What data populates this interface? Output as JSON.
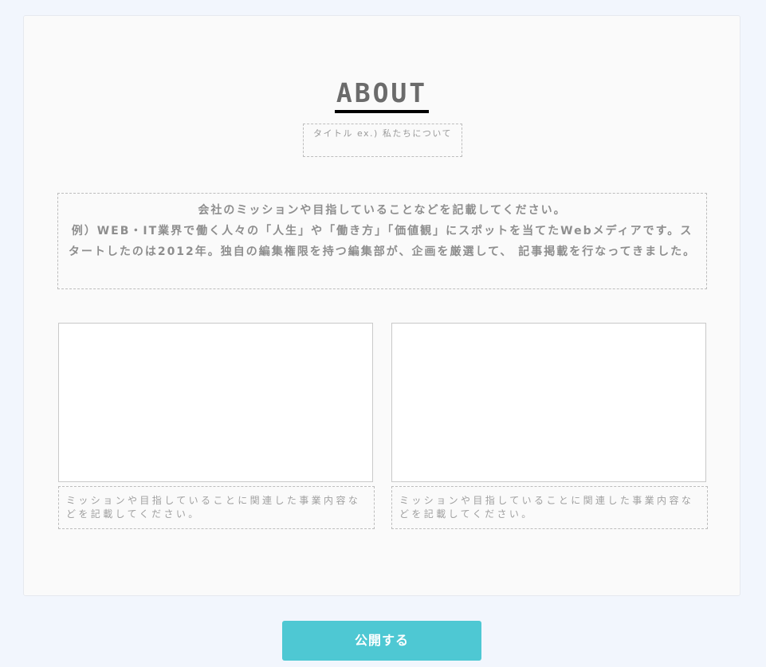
{
  "about": {
    "heading": "ABOUT",
    "subtitle_placeholder": "タイトル ex.) 私たちについて",
    "mission_lines": [
      "会社のミッションや目指していることなどを記載してください。",
      "例）WEB・IT業界で働く人々の「人生」や「働き方」「価値観」にスポットを当てたWebメディアです。スタートしたのは2012年。独自の編集権限を持つ編集部が、企画を厳選して、 記事掲載を行なってきました。"
    ],
    "business_items": [
      {
        "caption": "ミッションや目指していることに関連した事業内容などを記載してください。"
      },
      {
        "caption": "ミッションや目指していることに関連した事業内容などを記載してください。"
      }
    ]
  },
  "actions": {
    "publish_label": "公開する"
  },
  "colors": {
    "accent": "#4ec8d3",
    "page_background": "#f2f6fd",
    "card_background": "#fafafa"
  }
}
